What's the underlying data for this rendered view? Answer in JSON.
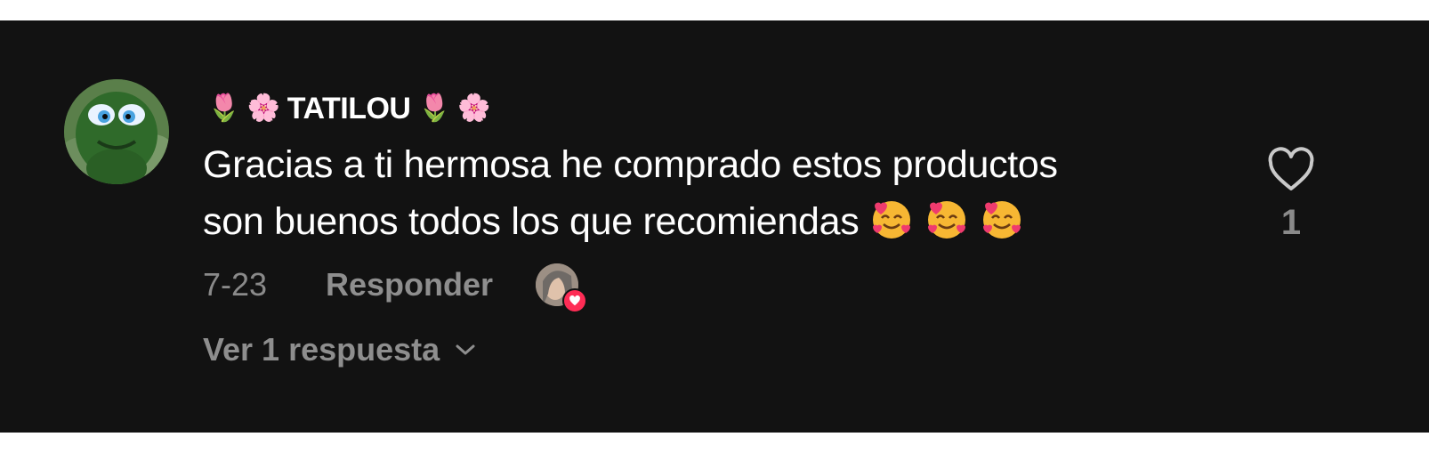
{
  "comment": {
    "username_prefix_emojis": [
      "🌷",
      "🌸"
    ],
    "username": "TATILOU",
    "username_suffix_emojis": [
      "🌷",
      "🌸"
    ],
    "text_line1": "Gracias a ti hermosa he comprado estos productos",
    "text_line2": "son buenos todos los que recomiendas",
    "trailing_emoji_icon": "smiling-face-with-hearts-icon",
    "date": "7-23",
    "reply_label": "Responder",
    "like_count": "1",
    "view_replies_label": "Ver 1 respuesta"
  },
  "colors": {
    "background": "#121212",
    "text_primary": "#ffffff",
    "text_secondary": "#8a8a8a",
    "like_badge": "#fe2c55"
  }
}
